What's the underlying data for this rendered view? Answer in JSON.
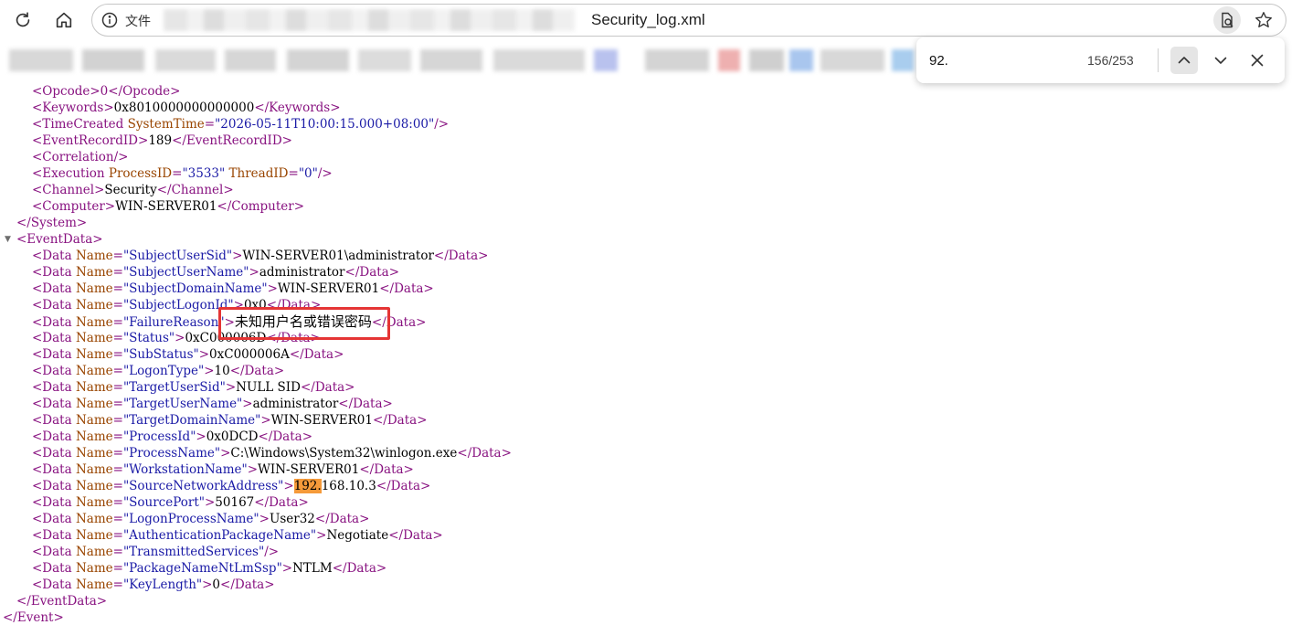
{
  "browser": {
    "scheme_label": "文件",
    "url_filename": "Security_log.xml"
  },
  "find": {
    "query": "92.",
    "count": "156/253"
  },
  "colors": {
    "tag": "#881280",
    "attr_name": "#994500",
    "attr_value": "#1a1aa6",
    "find_highlight": "#f59a3a",
    "annotation_box": "#e53535"
  },
  "xml": {
    "opcode": "<Opcode>0</Opcode>",
    "keywords_open": "<Keywords>",
    "keywords_val": "0x8010000000000000",
    "keywords_close": "</Keywords>",
    "timecreated_open": "<TimeCreated",
    "timecreated_attr": "SystemTime",
    "timecreated_val": "\"2026-05-11T10:00:15.000+08:00\"",
    "timecreated_close": "/>",
    "eventrecord_open": "<EventRecordID>",
    "eventrecord_val": "189",
    "eventrecord_close": "</EventRecordID>",
    "correlation": "<Correlation/>",
    "execution_open": "<Execution",
    "execution_attr1": "ProcessID",
    "execution_val1": "\"3533\"",
    "execution_attr2": "ThreadID",
    "execution_val2": "\"0\"",
    "execution_close": "/>",
    "channel_open": "<Channel>",
    "channel_val": "Security",
    "channel_close": "</Channel>",
    "computer_open": "<Computer>",
    "computer_val": "WIN-SERVER01",
    "computer_close": "</Computer>",
    "system_close": "</System>",
    "eventdata_toggle": "▼",
    "eventdata_open": "<EventData>",
    "data_open": "<Data",
    "data_attr": "Name",
    "data_close": "</Data>",
    "eventdata_close": "</EventData>",
    "event_close": "</Event>",
    "data_rows": [
      {
        "name": "\"SubjectUserSid\"",
        "value": "WIN-SERVER01\\administrator"
      },
      {
        "name": "\"SubjectUserName\"",
        "value": "administrator"
      },
      {
        "name": "\"SubjectDomainName\"",
        "value": "WIN-SERVER01"
      },
      {
        "name": "\"SubjectLogonId\"",
        "value": "0x0"
      },
      {
        "name": "\"FailureReason\"",
        "value": "未知用户名或错误密码"
      },
      {
        "name": "\"Status\"",
        "value": "0xC000006D"
      },
      {
        "name": "\"SubStatus\"",
        "value": "0xC000006A"
      },
      {
        "name": "\"LogonType\"",
        "value": "10"
      },
      {
        "name": "\"TargetUserSid\"",
        "value": "NULL SID"
      },
      {
        "name": "\"TargetUserName\"",
        "value": "administrator"
      },
      {
        "name": "\"TargetDomainName\"",
        "value": "WIN-SERVER01"
      },
      {
        "name": "\"ProcessId\"",
        "value": "0x0DCD"
      },
      {
        "name": "\"ProcessName\"",
        "value": "C:\\Windows\\System32\\winlogon.exe"
      },
      {
        "name": "\"WorkstationName\"",
        "value": "WIN-SERVER01"
      },
      {
        "name": "\"SourceNetworkAddress\"",
        "value_highlight": "192.",
        "value": "168.10.3"
      },
      {
        "name": "\"SourcePort\"",
        "value": "50167"
      },
      {
        "name": "\"LogonProcessName\"",
        "value": "User32"
      },
      {
        "name": "\"AuthenticationPackageName\"",
        "value": "Negotiate"
      },
      {
        "name": "\"TransmittedServices\"",
        "selfclose": "/>"
      },
      {
        "name": "\"PackageNameNtLmSsp\"",
        "value": "NTLM"
      },
      {
        "name": "\"KeyLength\"",
        "value": "0"
      }
    ]
  }
}
